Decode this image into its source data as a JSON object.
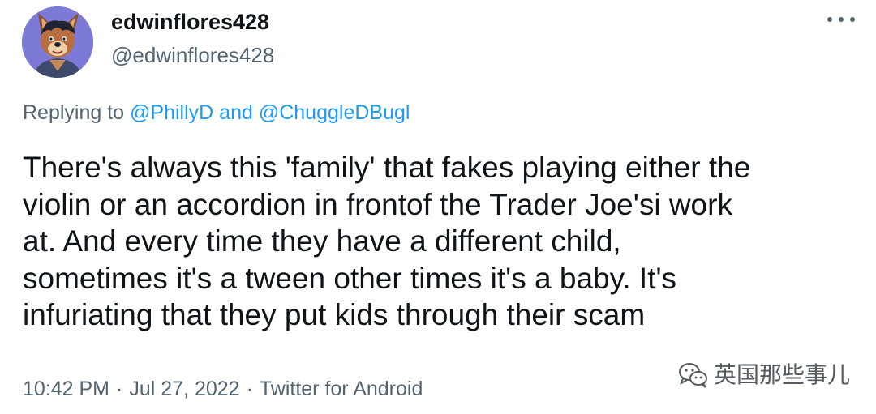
{
  "author": {
    "display_name": "edwinflores428",
    "handle": "@edwinflores428",
    "avatar_icon": "wolf-avatar-icon"
  },
  "more_icon": "more-horizontal-icon",
  "reply": {
    "prefix": "Replying to",
    "mention1": "@PhillyD",
    "conjunction": "and",
    "mention2": "@ChuggleDBugl"
  },
  "tweet": {
    "lines": [
      "There's always this 'family' that fakes playing either the",
      "violin or an accordion in frontof the Trader Joe'si work",
      "at. And every time they have a different child,",
      "sometimes it's a tween other times it's a baby. It's",
      "infuriating that they put kids through their scam"
    ]
  },
  "meta": {
    "time": "10:42 PM",
    "separator": "·",
    "date": "Jul 27, 2022",
    "source": "Twitter for Android"
  },
  "watermark": {
    "icon": "wechat-icon",
    "text": "英国那些事儿"
  },
  "colors": {
    "accent": "#1d9bf0",
    "secondary_text": "#536471",
    "primary_text": "#0f1419",
    "avatar_bg": "#7d79d6"
  }
}
